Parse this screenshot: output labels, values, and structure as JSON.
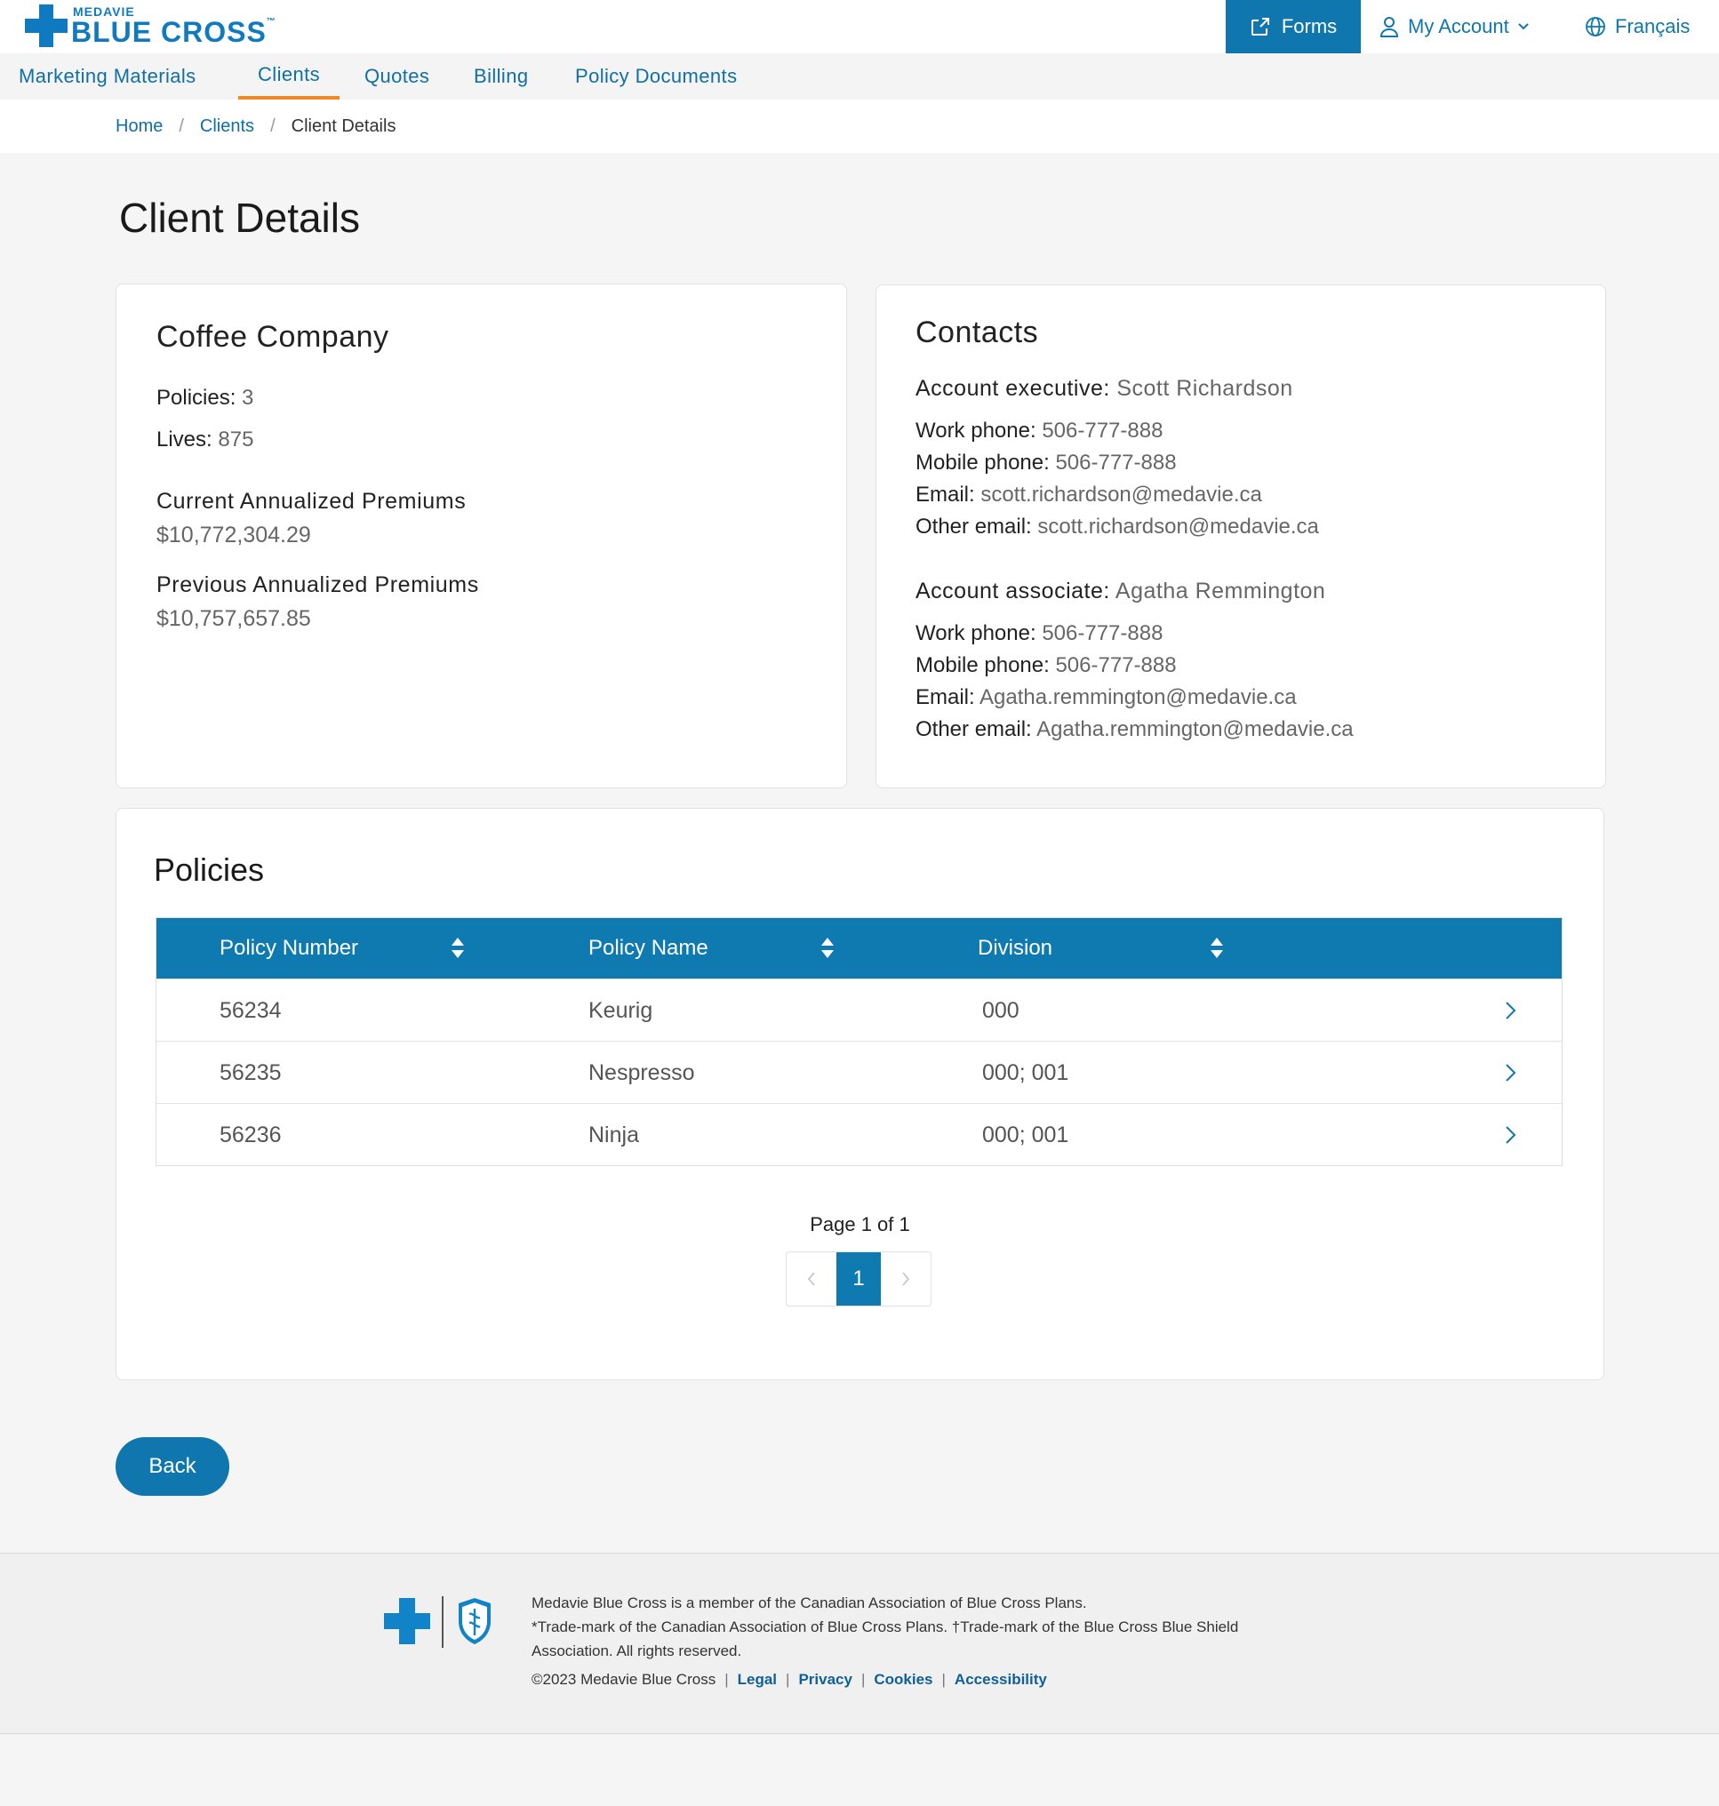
{
  "header": {
    "logo_small": "MEDAVIE",
    "logo_big": "BLUE CROSS",
    "logo_tm": "™",
    "forms_label": "Forms",
    "account_label": "My Account",
    "language_label": "Français"
  },
  "nav": {
    "items": [
      "Marketing Materials",
      "Clients",
      "Quotes",
      "Billing",
      "Policy Documents"
    ],
    "active": "Clients"
  },
  "breadcrumb": {
    "home": "Home",
    "clients": "Clients",
    "current": "Client Details",
    "separator": "/"
  },
  "page_title": "Client Details",
  "company": {
    "name": "Coffee Company",
    "policies_label": "Policies:",
    "policies_value": "3",
    "lives_label": "Lives:",
    "lives_value": "875",
    "current_premiums_label": "Current Annualized Premiums",
    "current_premiums_value": "$10,772,304.29",
    "previous_premiums_label": "Previous Annualized Premiums",
    "previous_premiums_value": "$10,757,657.85"
  },
  "contacts": {
    "title": "Contacts",
    "executive": {
      "role_label": "Account executive",
      "name": "Scott Richardson",
      "work_phone_label": "Work phone:",
      "work_phone": "506-777-888",
      "mobile_phone_label": "Mobile phone:",
      "mobile_phone": "506-777-888",
      "email_label": "Email:",
      "email": "scott.richardson@medavie.ca",
      "other_email_label": "Other email:",
      "other_email": "scott.richardson@medavie.ca"
    },
    "associate": {
      "role_label": "Account associate",
      "name": "Agatha Remmington",
      "work_phone_label": "Work phone:",
      "work_phone": "506-777-888",
      "mobile_phone_label": "Mobile phone:",
      "mobile_phone": "506-777-888",
      "email_label": "Email:",
      "email": "Agatha.remmington@medavie.ca",
      "other_email_label": "Other email:",
      "other_email": "Agatha.remmington@medavie.ca"
    }
  },
  "policies": {
    "title": "Policies",
    "columns": [
      "Policy Number",
      "Policy Name",
      "Division"
    ],
    "rows": [
      {
        "number": "56234",
        "name": "Keurig",
        "division": "000"
      },
      {
        "number": "56235",
        "name": "Nespresso",
        "division": "000; 001"
      },
      {
        "number": "56236",
        "name": "Ninja",
        "division": "000; 001"
      }
    ],
    "page_info": "Page 1 of 1",
    "current_page": "1"
  },
  "back_label": "Back",
  "footer": {
    "line1": "Medavie Blue Cross is a member of the Canadian Association of Blue Cross Plans.",
    "line2": "*Trade-mark of the Canadian Association of Blue Cross Plans. †Trade-mark of the Blue Cross Blue Shield Association. All rights reserved.",
    "copyright": "©2023 Medavie Blue Cross",
    "links": [
      "Legal",
      "Privacy",
      "Cookies",
      "Accessibility"
    ]
  },
  "colors": {
    "brand_blue": "#0f76ae",
    "active_tab_underline": "#f08a24",
    "table_header": "#0f7ab0"
  }
}
